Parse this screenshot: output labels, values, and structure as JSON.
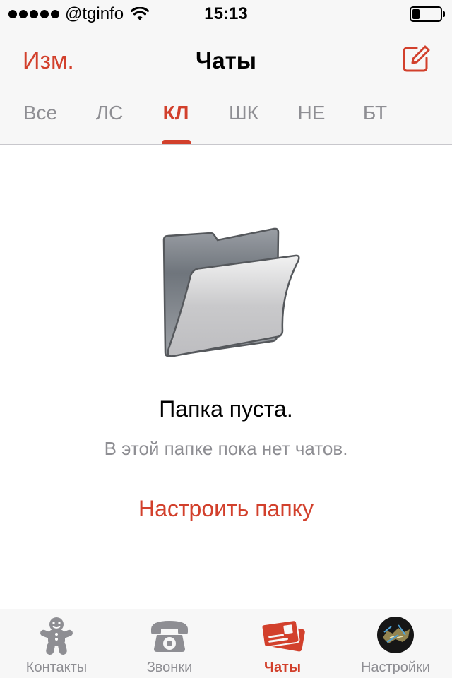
{
  "status_bar": {
    "carrier": "@tginfo",
    "time": "15:13",
    "battery_level": 0.25
  },
  "nav": {
    "edit_label": "Изм.",
    "title": "Чаты",
    "compose_icon": "compose-icon"
  },
  "tabs": [
    {
      "label": "Все",
      "active": false
    },
    {
      "label": "ЛС",
      "active": false
    },
    {
      "label": "КЛ",
      "active": true
    },
    {
      "label": "ШК",
      "active": false
    },
    {
      "label": "НЕ",
      "active": false
    },
    {
      "label": "БТ",
      "active": false
    }
  ],
  "empty_state": {
    "icon": "folder-icon",
    "title": "Папка пуста.",
    "subtitle": "В этой папке пока нет чатов.",
    "action_label": "Настроить папку"
  },
  "tab_bar": [
    {
      "label": "Контакты",
      "icon": "gingerbread-icon",
      "active": false
    },
    {
      "label": "Звонки",
      "icon": "phone-icon",
      "active": false
    },
    {
      "label": "Чаты",
      "icon": "chats-icon",
      "active": true
    },
    {
      "label": "Настройки",
      "icon": "avatar",
      "active": false
    }
  ],
  "colors": {
    "accent": "#d2402c",
    "inactive": "#8e8e93",
    "bar_background": "#f7f7f7"
  }
}
